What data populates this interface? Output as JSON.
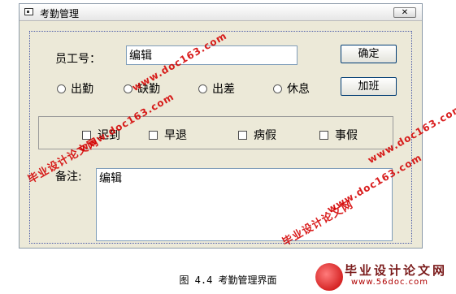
{
  "window": {
    "title": "考勤管理",
    "close_glyph": "✕"
  },
  "form": {
    "employee_label": "员工号：",
    "employee_value": "编辑",
    "confirm_button": "确定",
    "overtime_button": "加班",
    "radios": [
      "出勤",
      "缺勤",
      "出差",
      "休息"
    ],
    "checks": [
      "迟到",
      "早退",
      "病假",
      "事假"
    ],
    "remarks_label": "备注:",
    "remarks_value": "编辑"
  },
  "caption": "图 4.4 考勤管理界面",
  "watermarks": {
    "cn": "毕业设计论文网",
    "url": "www.doc163.com",
    "logo_text": "毕业设计论文网",
    "logo_url": "www.56doc.com"
  }
}
